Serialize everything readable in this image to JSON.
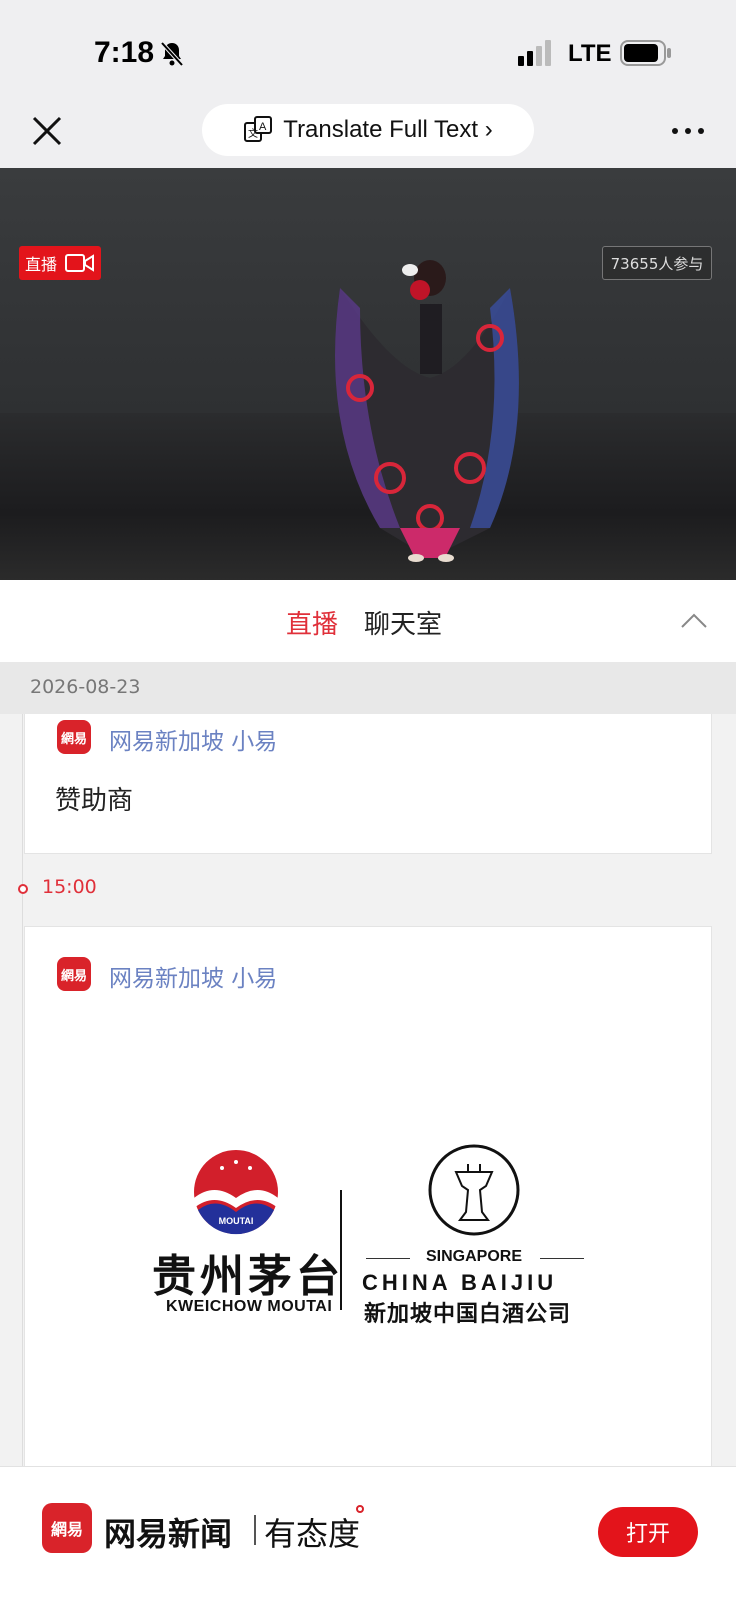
{
  "status_bar": {
    "time": "7:18",
    "network": "LTE"
  },
  "nav": {
    "translate_label": "Translate Full Text ›"
  },
  "video": {
    "live_badge": "直播",
    "participants": "73655人参与"
  },
  "tabs": {
    "live": "直播",
    "chat": "聊天室"
  },
  "feed": {
    "date": "2026-08-23",
    "posts": [
      {
        "avatar": "網易",
        "author": "网易新加坡 小易",
        "text": "赞助商"
      },
      {
        "time": "15:00",
        "avatar": "網易",
        "author": "网易新加坡 小易"
      }
    ],
    "sponsor": {
      "moutai_cn": "贵州茅台",
      "moutai_en": "KWEICHOW MOUTAI",
      "moutai_badge": "MOUTAI",
      "sg_label": "SINGAPORE",
      "baijiu_en": "CHINA BAIJIU",
      "baijiu_cn": "新加坡中国白酒公司"
    }
  },
  "banner": {
    "logo_text": "網易",
    "app_name": "网易新闻",
    "slogan": "有态度",
    "open_label": "打开"
  },
  "colors": {
    "accent_red": "#e3141b",
    "author_blue": "#6b82c2"
  }
}
